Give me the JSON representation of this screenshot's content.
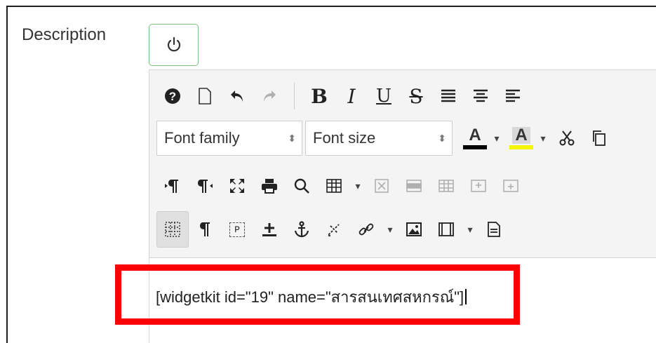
{
  "form": {
    "description_label": "Description"
  },
  "toggle": {
    "icon": "power-icon"
  },
  "toolbar": {
    "row1": [
      {
        "name": "help-icon",
        "glyph": "❓"
      },
      {
        "name": "new-document-icon",
        "glyph": "🗋"
      },
      {
        "name": "undo-icon",
        "glyph": "⭠"
      },
      {
        "name": "redo-icon",
        "glyph": "⭢"
      },
      {
        "name": "bold-button",
        "glyph": "B"
      },
      {
        "name": "italic-button",
        "glyph": "I"
      },
      {
        "name": "underline-button",
        "glyph": "U"
      },
      {
        "name": "strikethrough-button",
        "glyph": "S"
      },
      {
        "name": "align-justify-icon",
        "glyph": "≣"
      },
      {
        "name": "align-center-icon",
        "glyph": "☰"
      },
      {
        "name": "align-left-icon",
        "glyph": "☰"
      }
    ],
    "font_family_label": "Font family",
    "font_size_label": "Font size",
    "select_arrows": "⬍",
    "text_color_label": "A",
    "bg_color_label": "A",
    "caret": "▾",
    "text_color": "#000000",
    "bg_color": "#f5f500",
    "row4_p_label": "P"
  },
  "content": {
    "text": "[widgetkit id=\"19\" name=\"สารสนเทศสหกรณ์\"]"
  },
  "colors": {
    "accent_green": "#7cc27c",
    "highlight_red": "#ff0000"
  }
}
